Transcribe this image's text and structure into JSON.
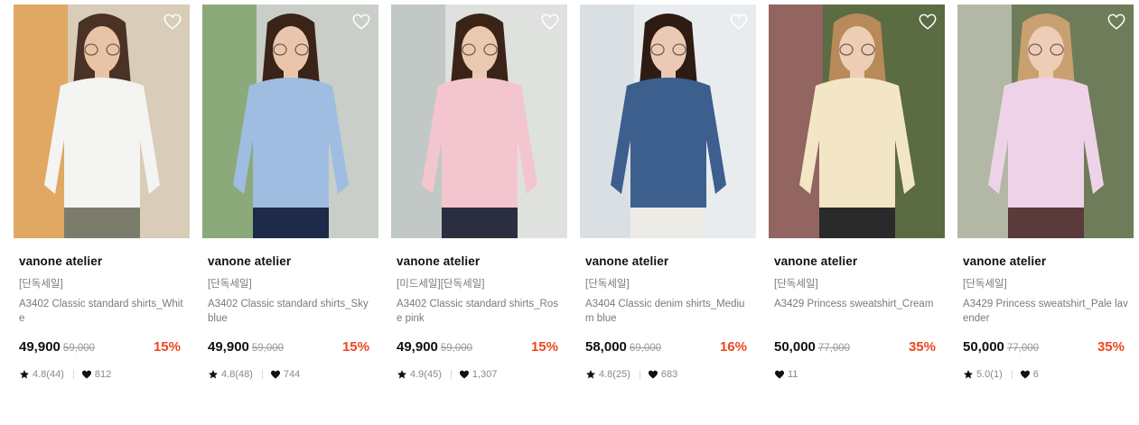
{
  "products": [
    {
      "brand": "vanone atelier",
      "tag": "[단독세일]",
      "title": "A3402 Classic standard shirts_White",
      "price": "49,900",
      "original_price": "59,000",
      "discount": "15%",
      "rating": "4.8(44)",
      "likes": "812",
      "has_rating": true,
      "photo": {
        "bg": "#d9cdb9",
        "accent": "#e58a1c",
        "shirt": "#f4f4f2",
        "pants": "#7b7c6c",
        "hair": "#4a3224",
        "skin": "#e8c3a6"
      },
      "wishlist_icon": "heart-outline-icon"
    },
    {
      "brand": "vanone atelier",
      "tag": "[단독세일]",
      "title": "A3402 Classic standard shirts_Sky blue",
      "price": "49,900",
      "original_price": "59,000",
      "discount": "15%",
      "rating": "4.8(48)",
      "likes": "744",
      "has_rating": true,
      "photo": {
        "bg": "#c9cfc8",
        "accent": "#5a8a3a",
        "shirt": "#9fbde0",
        "pants": "#1e2a4a",
        "hair": "#3a2418",
        "skin": "#e9c6ab"
      },
      "wishlist_icon": "heart-outline-icon"
    },
    {
      "brand": "vanone atelier",
      "tag": "[미드세일][단독세일]",
      "title": "A3402 Classic standard shirts_Rose pink",
      "price": "49,900",
      "original_price": "59,000",
      "discount": "15%",
      "rating": "4.9(45)",
      "likes": "1,307",
      "has_rating": true,
      "photo": {
        "bg": "#dfe1df",
        "accent": "#a9b4ae",
        "shirt": "#f3c6cf",
        "pants": "#2a2e40",
        "hair": "#3a2418",
        "skin": "#ebc8b0"
      },
      "wishlist_icon": "heart-outline-icon"
    },
    {
      "brand": "vanone atelier",
      "tag": "[단독세일]",
      "title": "A3404 Classic denim shirts_Medium blue",
      "price": "58,000",
      "original_price": "69,000",
      "discount": "16%",
      "rating": "4.8(25)",
      "likes": "683",
      "has_rating": true,
      "photo": {
        "bg": "#e8ecee",
        "accent": "#cdd6dc",
        "shirt": "#3d5f8e",
        "pants": "#ecebe6",
        "hair": "#2e1c14",
        "skin": "#ecc9b2"
      },
      "wishlist_icon": "heart-outline-icon"
    },
    {
      "brand": "vanone atelier",
      "tag": "[단독세일]",
      "title": "A3429 Princess sweatshirt_Cream",
      "price": "50,000",
      "original_price": "77,000",
      "discount": "35%",
      "rating": "",
      "likes": "11",
      "has_rating": false,
      "photo": {
        "bg": "#5b6b42",
        "accent": "#c0607a",
        "shirt": "#f3e6c6",
        "pants": "#2a2a2a",
        "hair": "#b88a5a",
        "skin": "#edcdb4"
      },
      "wishlist_icon": "heart-outline-icon"
    },
    {
      "brand": "vanone atelier",
      "tag": "[단독세일]",
      "title": "A3429 Princess sweatshirt_Pale lavender",
      "price": "50,000",
      "original_price": "77,000",
      "discount": "35%",
      "rating": "5.0(1)",
      "likes": "6",
      "has_rating": true,
      "photo": {
        "bg": "#6f7c5a",
        "accent": "#e9e9e4",
        "shirt": "#eed3e8",
        "pants": "#5a3a3a",
        "hair": "#c9a070",
        "skin": "#eecdb6"
      },
      "wishlist_icon": "heart-outline-icon"
    }
  ],
  "colors": {
    "discount": "#f0461e",
    "muted_text": "#7a7a7a",
    "strike_text": "#9a9a9a"
  },
  "icons": {
    "rating": "star-icon",
    "likes": "heart-filled-icon"
  }
}
